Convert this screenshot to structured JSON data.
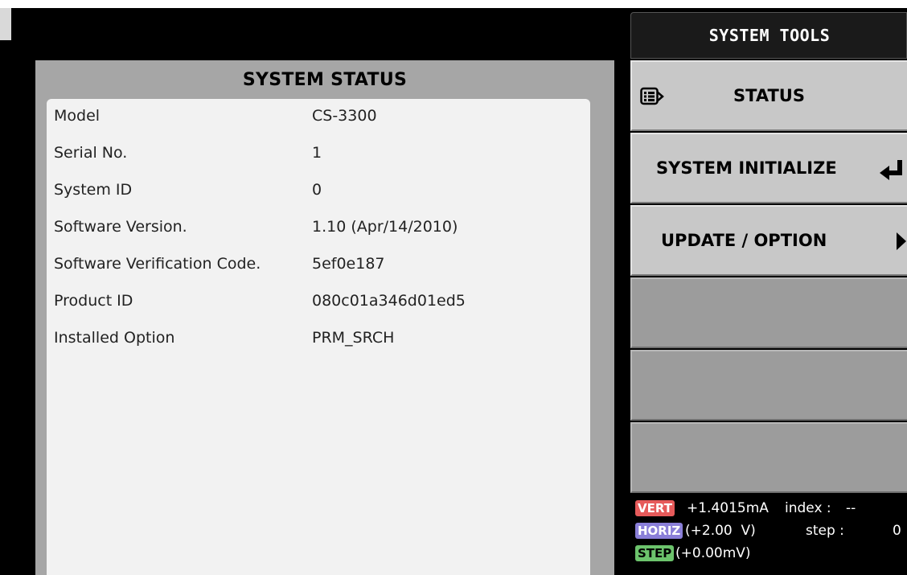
{
  "status_panel": {
    "title": "SYSTEM STATUS",
    "rows": [
      {
        "label": "Model",
        "value": "CS-3300"
      },
      {
        "label": "Serial No.",
        "value": "1"
      },
      {
        "label": "System ID",
        "value": "0"
      },
      {
        "label": "Software Version.",
        "value": "1.10 (Apr/14/2010)"
      },
      {
        "label": "Software Verification Code.",
        "value": "5ef0e187"
      },
      {
        "label": "Product ID",
        "value": "080c01a346d01ed5"
      },
      {
        "label": "Installed Option",
        "value": "PRM_SRCH"
      }
    ]
  },
  "tools_panel": {
    "title": "SYSTEM TOOLS",
    "buttons": [
      {
        "label": "STATUS",
        "icon": "list-icon"
      },
      {
        "label": "SYSTEM INITIALIZE",
        "icon": "enter-arrow-icon"
      },
      {
        "label": "UPDATE / OPTION",
        "icon": "play-arrow-icon"
      }
    ]
  },
  "readout": {
    "vert_tag": "VERT",
    "vert_value": "+1.4015mA",
    "index_label": "index :",
    "index_value": "--",
    "horiz_tag": "HORIZ",
    "horiz_value": "(+2.00  V)",
    "step_label": "step :",
    "step_value": "0",
    "step_tag": "STEP",
    "step_tag_value": "(+0.00mV)"
  },
  "colors": {
    "vert_tag": "#e65a5a",
    "horiz_tag": "#8a7fd8",
    "step_tag": "#6cc36c",
    "button_bg": "#c8c8c8",
    "empty_button_bg": "#9c9c9c",
    "panel_bg": "#a6a6a6"
  }
}
